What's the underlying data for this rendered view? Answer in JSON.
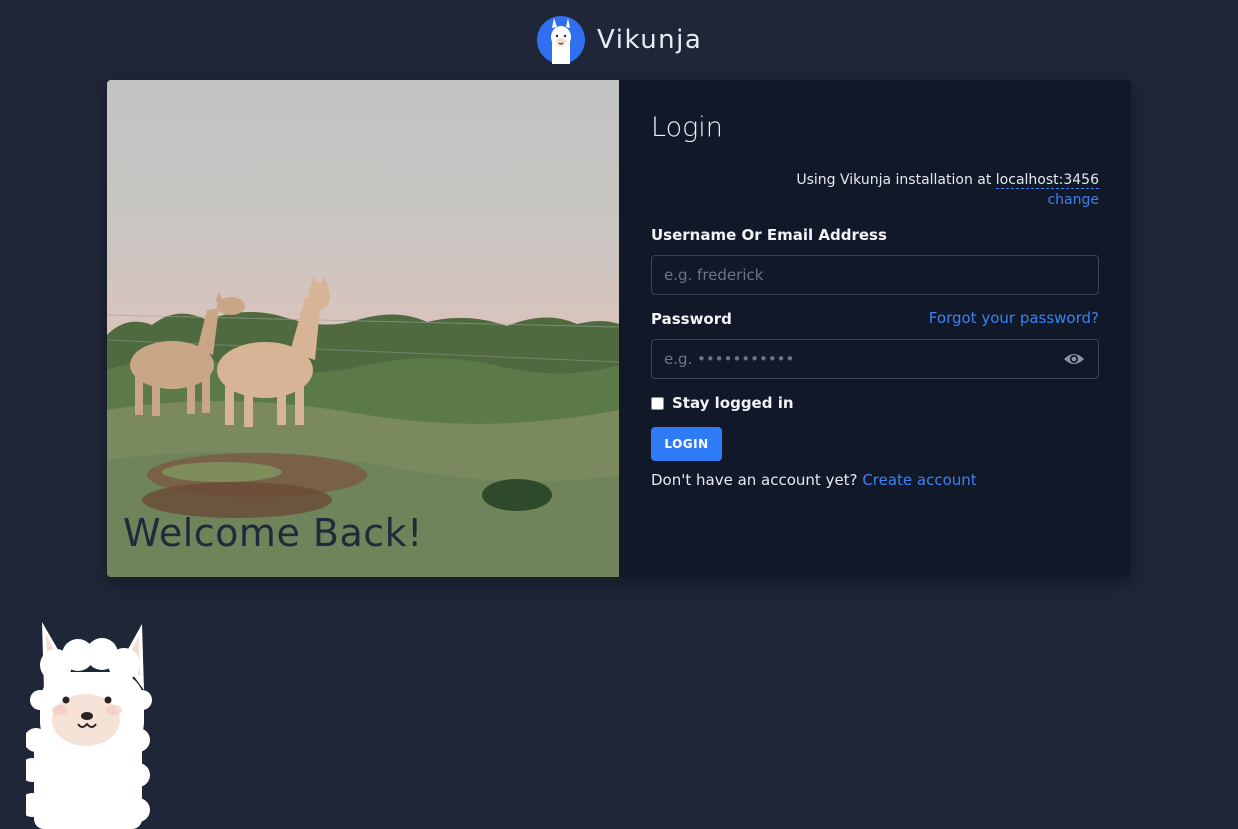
{
  "header": {
    "brand_name": "Vikunja",
    "logo_icon": "llama-logo-icon"
  },
  "hero": {
    "welcome_text": "Welcome Back!"
  },
  "login": {
    "title": "Login",
    "install_prefix": "Using Vikunja installation at",
    "install_host": "localhost:3456",
    "change_label": "change",
    "username_label": "Username Or Email Address",
    "username_placeholder": "e.g. frederick",
    "username_value": "",
    "password_label": "Password",
    "forgot_label": "Forgot your password?",
    "password_placeholder": "e.g. •••••••••••",
    "password_value": "",
    "show_password_icon": "eye-icon",
    "stay_logged_in_label": "Stay logged in",
    "stay_logged_in_checked": false,
    "login_button_label": "LOGIN",
    "no_account_text": "Don't have an account yet?",
    "create_account_label": "Create account"
  },
  "colors": {
    "background": "#1f2637",
    "panel": "#111827",
    "accent": "#3b82f6",
    "button": "#2f7af7"
  }
}
